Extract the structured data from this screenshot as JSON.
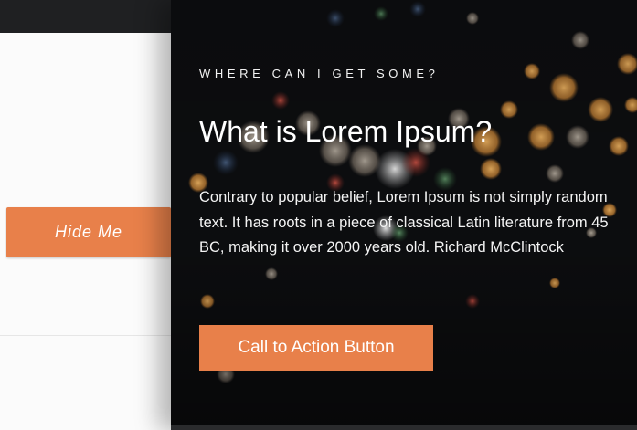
{
  "left_panel": {
    "hide_button_label": "Hide Me"
  },
  "overlay": {
    "eyebrow": "WHERE CAN I GET SOME?",
    "heading": "What is Lorem Ipsum?",
    "body": "Contrary to popular belief, Lorem Ipsum is not simply random text. It has roots in a piece of classical Latin literature from 45 BC, making it over 2000 years old. Richard McClintock",
    "cta_label": "Call to Action Button"
  },
  "colors": {
    "accent": "#e8804a",
    "overlay_bg": "#0a0b0c",
    "page_bg": "#f7f7f7",
    "top_bar": "#1f2022"
  }
}
